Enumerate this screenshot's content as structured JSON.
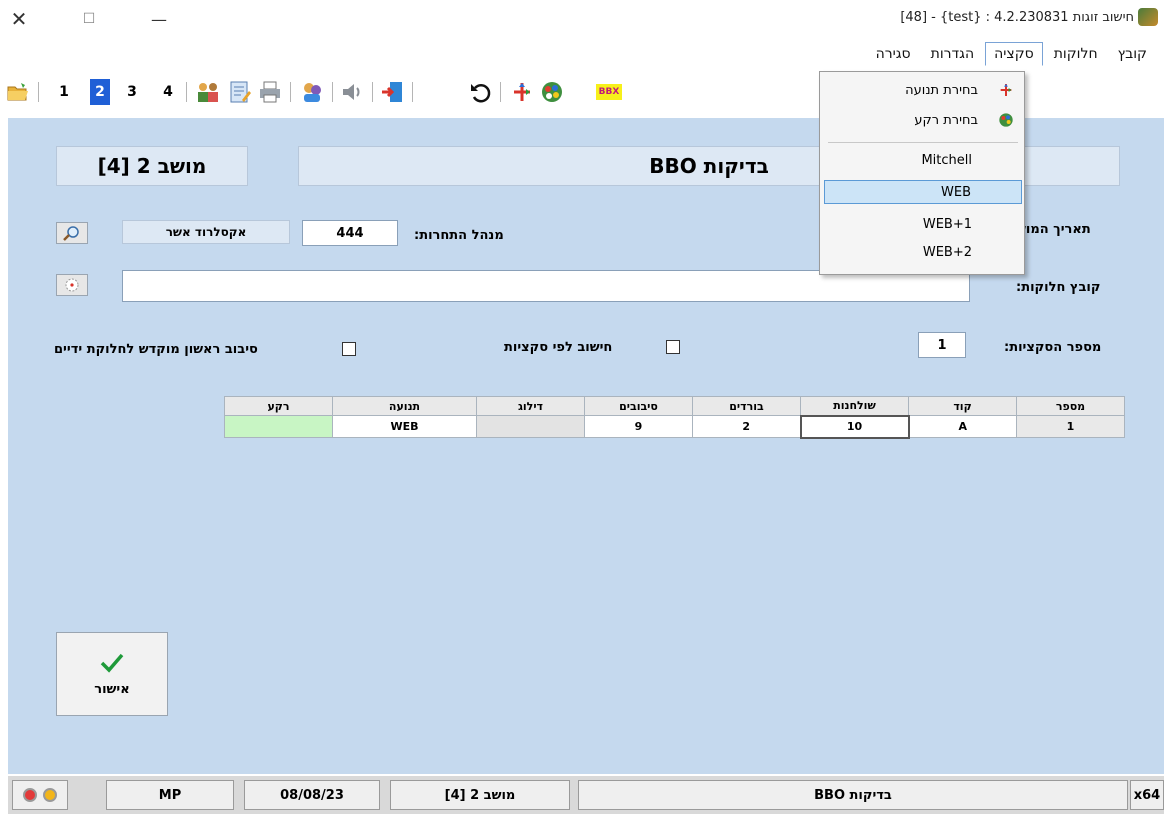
{
  "window": {
    "title": "[48] - {test} : 4.2.230831 חישוב זוגות",
    "close_glyph": "✕",
    "maximize_glyph": "☐",
    "minimize_glyph": "—"
  },
  "menu": {
    "items": [
      "קובץ",
      "חלוקות",
      "סקציה",
      "הגדרות",
      "סגירה"
    ],
    "active": "סקציה"
  },
  "toolbar": {
    "numbers": [
      "1",
      "2",
      "3",
      "4"
    ],
    "selected_number": "2",
    "bbx_label": "BBX"
  },
  "header": {
    "session": "מושב 2 [4]",
    "title": "BBO בדיקות"
  },
  "form": {
    "date_label": "תאריך המוש",
    "director_label": "מנהל התחרות:",
    "director_code": "444",
    "director_name": "אקסלרוד אשר",
    "file_label": "קובץ חלוקות:",
    "file_value": "",
    "sections_label": "מספר הסקציות:",
    "sections_count": "1",
    "calc_by_section_label": "חישוב לפי סקציות",
    "first_round_label": "סיבוב ראשון מוקדש לחלוקת ידיים"
  },
  "table": {
    "headers": [
      "מספר",
      "קוד",
      "שולחנות",
      "בורדים",
      "סיבובים",
      "דילוג",
      "תנועה",
      "רקע"
    ],
    "rows": [
      [
        "1",
        "A",
        "10",
        "2",
        "9",
        "",
        "WEB",
        ""
      ]
    ],
    "background_color": "#c8f5c4"
  },
  "confirm": {
    "label": "אישור"
  },
  "dropdown": {
    "items": [
      {
        "label": "בחירת תנועה",
        "icon": "movement-icon"
      },
      {
        "label": "בחירת רקע",
        "icon": "palette-icon"
      },
      {
        "label": "Mitchell"
      },
      {
        "label": "WEB",
        "highlighted": true
      },
      {
        "label": "WEB+1"
      },
      {
        "label": "WEB+2"
      }
    ]
  },
  "status": {
    "mp": "MP",
    "date": "08/08/23",
    "session": "מושב 2 [4]",
    "title": "BBO בדיקות",
    "arch": "x64"
  }
}
